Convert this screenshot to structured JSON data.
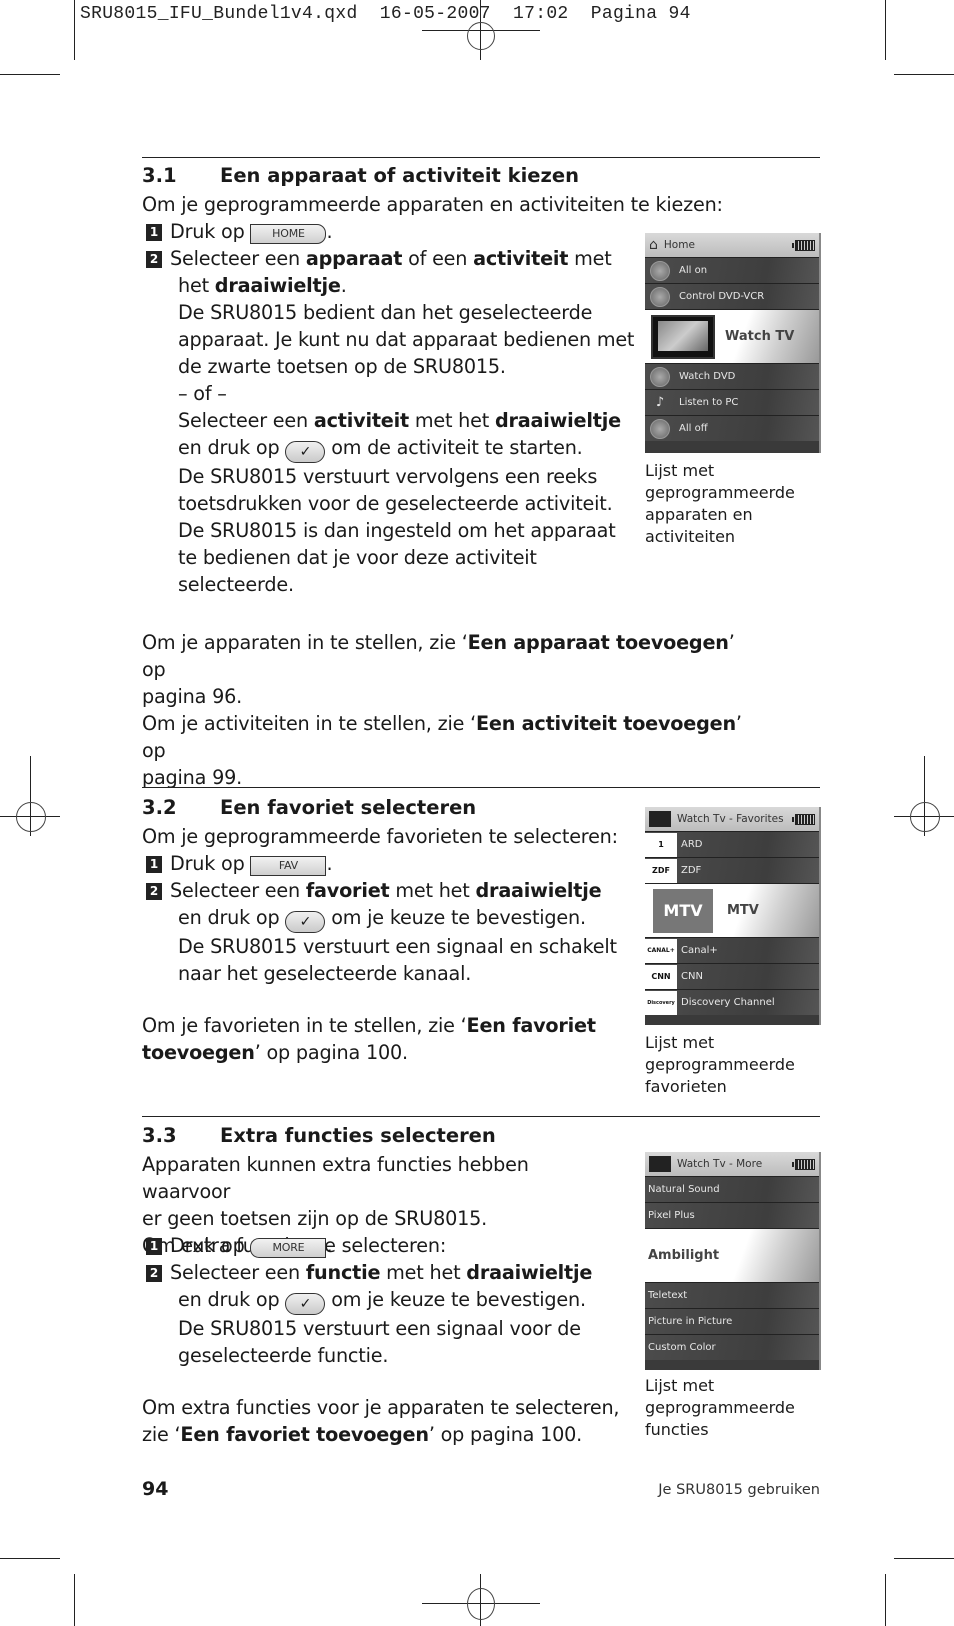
{
  "slug": {
    "filename": "SRU8015_IFU_Bundel1v4.qxd",
    "date": "16-05-2007",
    "time": "17:02",
    "page_label": "Pagina 94"
  },
  "sections": [
    {
      "number": "3.1",
      "title": "Een apparaat of activiteit kiezen",
      "intro": "Om je geprogrammeerde apparaten en activiteiten te kiezen:",
      "step1": {
        "num": "1",
        "prefix": "Druk op",
        "key": "HOME",
        "suffix": "."
      },
      "step2": {
        "num": "2",
        "l1a": "Selecteer een ",
        "l1b": "apparaat",
        "l1c": " of een ",
        "l1d": "activiteit",
        "l1e": " met",
        "l2a": "het ",
        "l2b": "draaiwieltje",
        "l2c": ".",
        "l3": "De SRU8015 bedient dan het geselecteerde",
        "l4": "apparaat. Je kunt nu dat apparaat bedienen met",
        "l5": "de zwarte toetsen op de SRU8015.",
        "l6": "– of –",
        "l7a": "Selecteer een ",
        "l7b": "activiteit",
        "l7c": " met het ",
        "l7d": "draaiwieltje",
        "l8a": "en druk op",
        "l8b": "om de activiteit te starten.",
        "l9": "De SRU8015 verstuurt vervolgens een reeks",
        "l10": "toetsdrukken voor de geselecteerde activiteit.",
        "l11": "De SRU8015 is dan ingesteld om het apparaat",
        "l12": "te bedienen dat je voor deze activiteit",
        "l13": "selecteerde."
      },
      "refs": {
        "r1a": "Om je apparaten in te stellen, zie ‘",
        "r1b": "Een apparaat toevoegen",
        "r1c": "’ op",
        "r1d": "pagina 96.",
        "r2a": "Om je activiteiten in te stellen, zie ‘",
        "r2b": "Een activiteit toevoegen",
        "r2c": "’ op",
        "r2d": "pagina 99."
      },
      "screen": {
        "header": "Home",
        "header_icon": "home-icon",
        "items": [
          {
            "label": "All on",
            "icon": "power-icon"
          },
          {
            "label": "Control DVD-VCR",
            "icon": "dvd-vcr-icon"
          },
          {
            "label": "Watch TV",
            "icon": "tv-icon",
            "selected": true
          },
          {
            "label": "Watch DVD",
            "icon": "dvd-icon"
          },
          {
            "label": "Listen to PC",
            "icon": "music-pc-icon"
          },
          {
            "label": "All off",
            "icon": "power-icon"
          }
        ]
      },
      "caption": [
        "Lijst met",
        "geprogrammeerde",
        "apparaten en",
        "activiteiten"
      ]
    },
    {
      "number": "3.2",
      "title": "Een favoriet selecteren",
      "intro": "Om je geprogrammeerde favorieten te selecteren:",
      "step1": {
        "num": "1",
        "prefix": "Druk op",
        "key": "FAV",
        "suffix": "."
      },
      "step2": {
        "num": "2",
        "l1a": "Selecteer een ",
        "l1b": "favoriet",
        "l1c": " met het ",
        "l1d": "draaiwieltje",
        "l2a": "en druk op",
        "l2b": "om je keuze te bevestigen.",
        "l3": "De SRU8015 verstuurt een signaal en schakelt",
        "l4": "naar het geselecteerde kanaal."
      },
      "refs": {
        "r1a": "Om je favorieten in te stellen, zie ‘",
        "r1b": "Een favoriet",
        "r1c": "toevoegen",
        "r1d": "’ op pagina 100."
      },
      "screen": {
        "header": "Watch Tv - Favorites",
        "items": [
          {
            "label": "ARD",
            "logo": "1"
          },
          {
            "label": "ZDF",
            "logo": "ZDF"
          },
          {
            "label": "MTV",
            "logo": "MTV",
            "selected": true
          },
          {
            "label": "Canal+",
            "logo": "CANAL+"
          },
          {
            "label": "CNN",
            "logo": "CNN"
          },
          {
            "label": "Discovery Channel",
            "logo": "Discovery"
          }
        ]
      },
      "caption": [
        "Lijst met",
        "geprogrammeerde",
        "favorieten"
      ]
    },
    {
      "number": "3.3",
      "title": "Extra functies selecteren",
      "intro1": "Apparaten kunnen extra functies hebben waarvoor",
      "intro2": "er geen toetsen zijn op de SRU8015.",
      "intro3": "Om extra functies te selecteren:",
      "step1": {
        "num": "1",
        "prefix": "Druk op",
        "key": "MORE",
        "suffix": "."
      },
      "step2": {
        "num": "2",
        "l1a": "Selecteer een ",
        "l1b": "functie",
        "l1c": " met het ",
        "l1d": "draaiwieltje",
        "l2a": "en druk op",
        "l2b": "om je keuze te bevestigen.",
        "l3": "De SRU8015 verstuurt een signaal voor de",
        "l4": "geselecteerde functie."
      },
      "refs": {
        "r1a": "Om extra functies voor je apparaten te selecteren,",
        "r1b": "zie ‘",
        "r1c": "Een favoriet toevoegen",
        "r1d": "’ op pagina 100."
      },
      "screen": {
        "header": "Watch Tv - More",
        "items": [
          {
            "label": "Natural Sound"
          },
          {
            "label": "Pixel Plus"
          },
          {
            "label": "Ambilight",
            "selected": true
          },
          {
            "label": "Teletext"
          },
          {
            "label": "Picture in Picture"
          },
          {
            "label": "Custom Color"
          }
        ]
      },
      "caption": [
        "Lijst met",
        "geprogrammeerde",
        "functies"
      ]
    }
  ],
  "ok_glyph": "✓",
  "footer": {
    "page_number": "94",
    "running_title": "Je SRU8015 gebruiken"
  }
}
